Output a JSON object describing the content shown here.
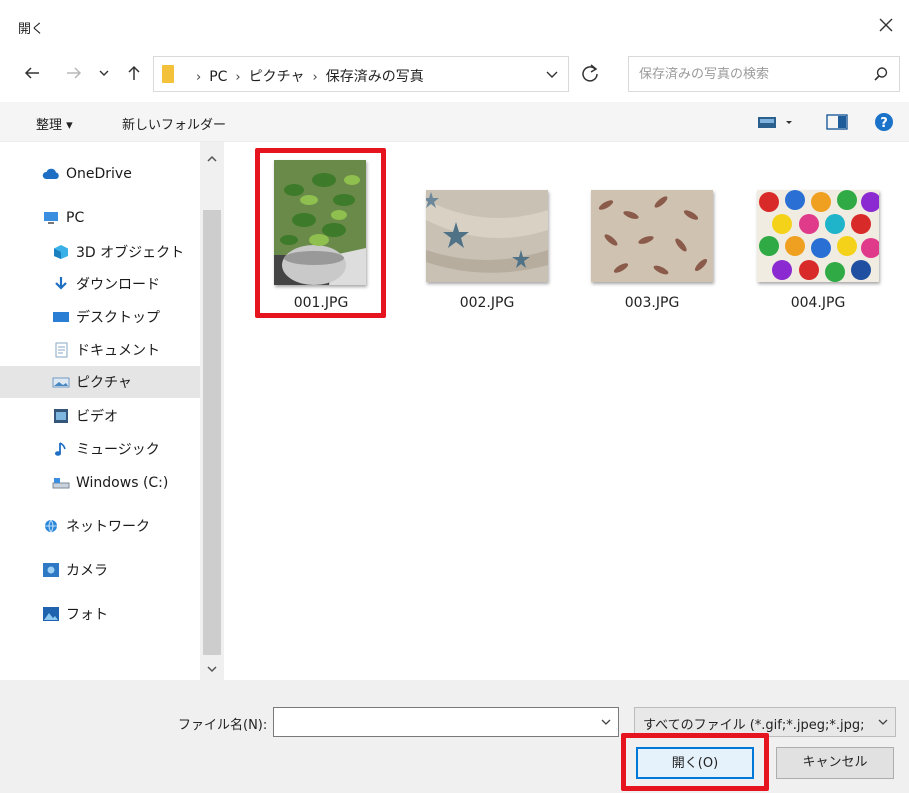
{
  "window": {
    "title": "開く"
  },
  "address": {
    "crumbs": [
      "PC",
      "ピクチャ",
      "保存済みの写真"
    ],
    "search_placeholder": "保存済みの写真の検索"
  },
  "toolbar": {
    "organize": "整理 ▾",
    "new_folder": "新しいフォルダー"
  },
  "sidebar": {
    "items": [
      {
        "label": "OneDrive",
        "icon": "cloud-icon"
      },
      {
        "label": "PC",
        "icon": "computer-icon"
      },
      {
        "label": "3D オブジェクト",
        "icon": "cube-icon"
      },
      {
        "label": "ダウンロード",
        "icon": "download-icon"
      },
      {
        "label": "デスクトップ",
        "icon": "desktop-icon"
      },
      {
        "label": "ドキュメント",
        "icon": "document-icon"
      },
      {
        "label": "ピクチャ",
        "icon": "pictures-icon",
        "selected": true
      },
      {
        "label": "ビデオ",
        "icon": "video-icon"
      },
      {
        "label": "ミュージック",
        "icon": "music-icon"
      },
      {
        "label": "Windows (C:)",
        "icon": "drive-icon"
      },
      {
        "label": "ネットワーク",
        "icon": "network-icon"
      },
      {
        "label": "カメラ",
        "icon": "camera-icon"
      },
      {
        "label": "フォト",
        "icon": "photos-icon"
      }
    ]
  },
  "files": [
    {
      "name": "001.JPG",
      "selected": true
    },
    {
      "name": "002.JPG"
    },
    {
      "name": "003.JPG"
    },
    {
      "name": "004.JPG"
    }
  ],
  "footer": {
    "filename_label": "ファイル名(N):",
    "filename_value": "",
    "filetype": "すべてのファイル (*.gif;*.jpeg;*.jpg;",
    "open_button": "開く(O)",
    "cancel_button": "キャンセル"
  },
  "colors": {
    "highlight": "#e6141e",
    "accent": "#0078d7",
    "help": "#1a73c9",
    "folder": "#f3c13a"
  }
}
